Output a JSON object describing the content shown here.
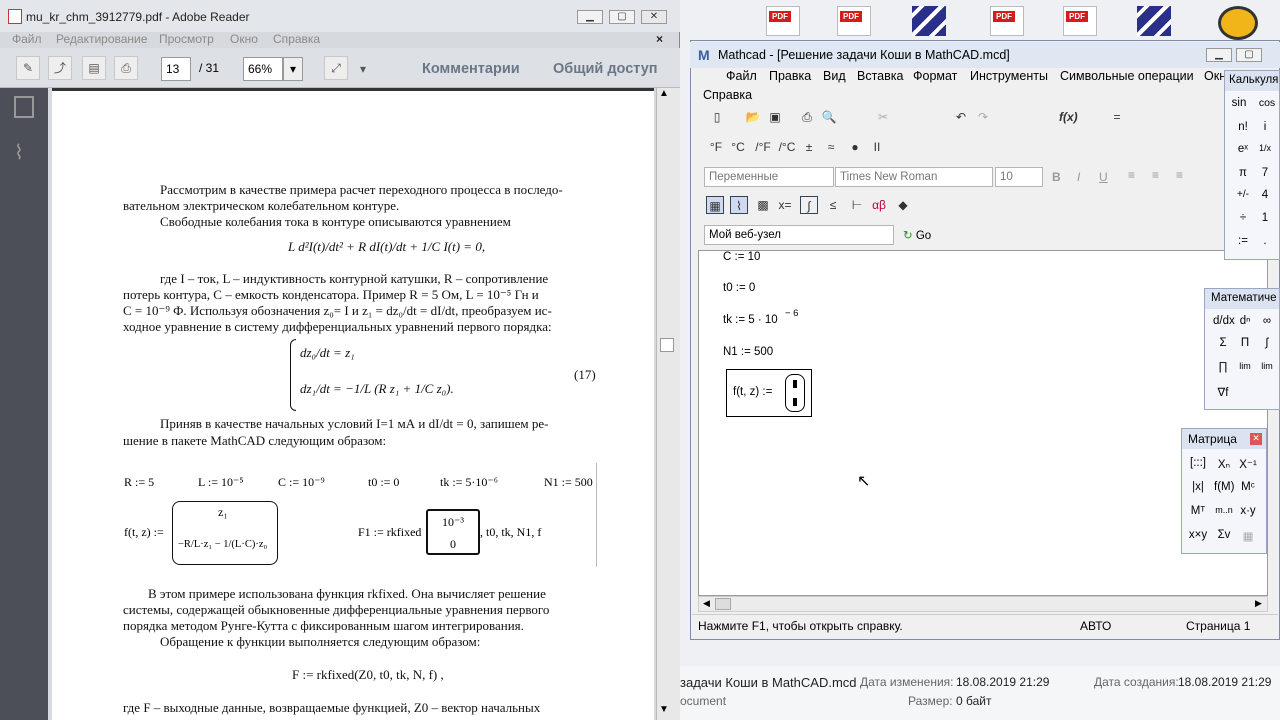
{
  "desktop": {
    "pdf_label": "PDF"
  },
  "explorer": {
    "name": "задачи Коши в MathCAD.mcd",
    "modified_label": "Дата изменения:",
    "modified": "18.08.2019 21:29",
    "created_label": "Дата создания:",
    "created": "18.08.2019 21:29",
    "size_label": "Размер:",
    "size": "0 байт",
    "type": "ocument"
  },
  "adobe": {
    "title": "mu_kr_chm_3912779.pdf - Adobe Reader",
    "menu": [
      "Файл",
      "Редактирование",
      "Просмотр",
      "Окно",
      "Справка"
    ],
    "page": "13",
    "pages": "/ 31",
    "zoom": "66%",
    "comments": "Комментарии",
    "share": "Общий доступ",
    "doc": {
      "p1": "Рассмотрим в качестве примера расчет переходного процесса в последо-",
      "p1b": "вательном электрическом колебательном контуре.",
      "p2": "Свободные колебания тока в контуре описываются уравнением",
      "eq1": "L d²I(t)/dt² + R dI(t)/dt + 1/C I(t) = 0,",
      "p3": "где I – ток, L – индуктивность контурной катушки, R – сопротивление",
      "p3b": "потерь контура, C – емкость конденсатора. Пример R = 5 Ом, L = 10⁻⁵ Гн и",
      "p3c": "C = 10⁻⁹ Ф. Используя обозначения z₀= I и z₁ = dz₀/dt = dI/dt, преобразуем ис-",
      "p3d": "ходное уравнение в систему дифференциальных уравнений первого порядка:",
      "sys1": "dz₀/dt = z₁",
      "sys2": "dz₁/dt = −1/L (R z₁ + 1/C z₀).",
      "eqnum": "(17)",
      "p4": "Приняв в качестве начальных условий I=1 мА и dI/dt = 0, запишем ре-",
      "p4b": "шение в пакете MathCAD следующим образом:",
      "m_r": "R := 5",
      "m_l": "L := 10⁻⁵",
      "m_c": "C := 10⁻⁹",
      "m_t0": "t0 := 0",
      "m_tk": "tk := 5·10⁻⁶",
      "m_n1": "N1 := 500",
      "m_f": "f(t, z) :=",
      "m_f_top": "z₁",
      "m_f_bot": "−R/L·z₁ − 1/(L·C)·z₀",
      "m_F1": "F1 := rkfixed",
      "m_F1_v1": "10⁻³",
      "m_F1_v2": "0",
      "m_F1_args": ", t0, tk, N1, f",
      "p5": "В этом примере использована функция rkfixed. Она вычисляет решение",
      "p5b": "системы, содержащей обыкновенные дифференциальные уравнения первого",
      "p5c": "порядка методом Рунге-Кутта с фиксированным шагом интегрирования.",
      "p6": "Обращение к функции выполняется следующим образом:",
      "call": "F := rkfixed(Z0, t0, tk, N, f)  ,",
      "p7": "где F – выходные данные, возвращаемые функцией, Z0 – вектор начальных"
    }
  },
  "mathcad": {
    "title": "Mathcad - [Решение задачи Коши в MathCAD.mcd]",
    "menu": [
      "Файл",
      "Правка",
      "Вид",
      "Вставка",
      "Формат",
      "Инструменты",
      "Символьные операции",
      "Окн"
    ],
    "menu2": "Справка",
    "style_combo": "Переменные",
    "font_combo": "Times New Roman",
    "size_combo": "10",
    "web_combo": "Мой веб-узел",
    "go": "Go",
    "units": [
      "°F",
      "°C",
      "/°F",
      "/°C",
      "±",
      "≈",
      "●",
      "II"
    ],
    "expr": {
      "c": "C := 10",
      "t0": "t0 := 0",
      "tk": "tk := 5 · 10",
      "tk_exp": "− 6",
      "n1": "N1 := 500",
      "f": "f(t, z) :="
    },
    "status": {
      "help": "Нажмите F1, чтобы открыть справку.",
      "mode": "АВТО",
      "page": "Страница 1"
    }
  },
  "calc": {
    "title": "Калькуля",
    "items": [
      "sin",
      "cos",
      "n!",
      "i",
      "eˣ",
      "1/x",
      "π",
      "7",
      "+/-",
      "4",
      "÷",
      "1",
      ":=",
      "."
    ]
  },
  "mathpal": {
    "title": "Математиче"
  },
  "matrix": {
    "title": "Матрица",
    "items": [
      "[:::]",
      "Xₙ",
      "X⁻¹",
      "|x|",
      "f(M)",
      "Mᶜ",
      "Mᵀ",
      "m..n",
      "x·y",
      "x×y",
      "Σv",
      "▦"
    ]
  }
}
